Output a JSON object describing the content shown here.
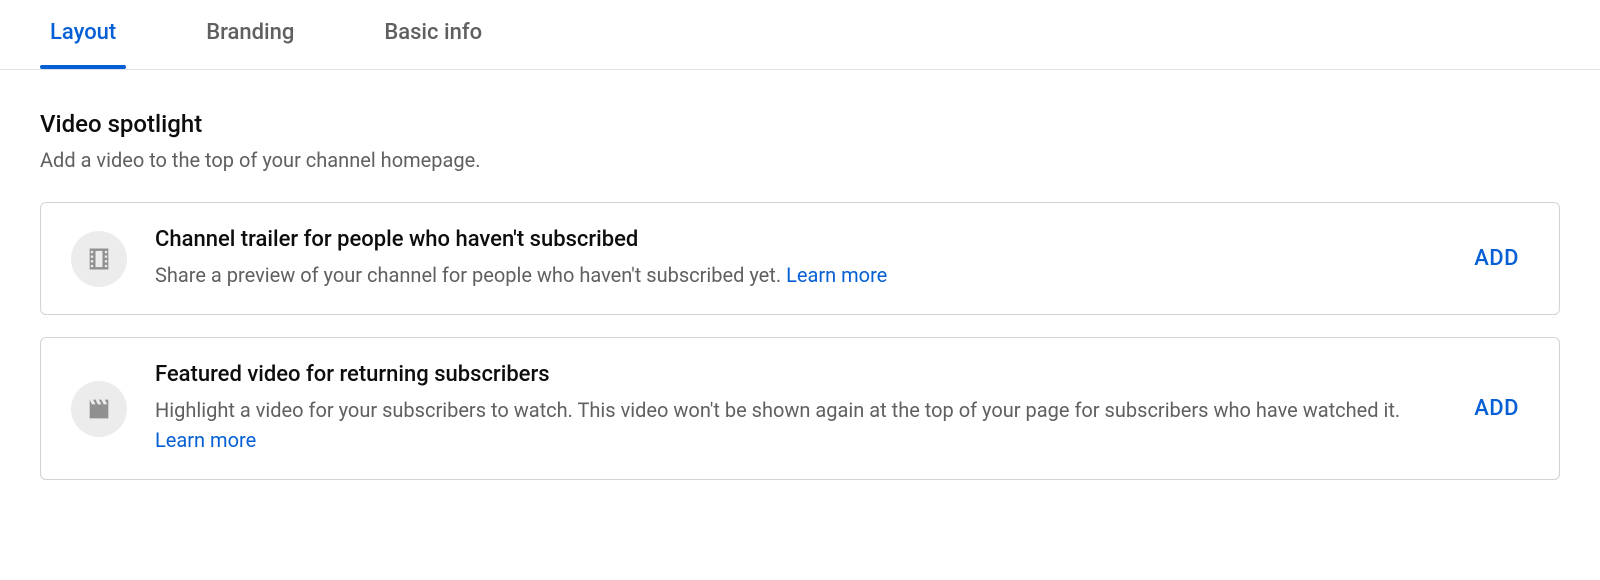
{
  "tabs": {
    "layout": "Layout",
    "branding": "Branding",
    "basic_info": "Basic info"
  },
  "section": {
    "title": "Video spotlight",
    "subtitle": "Add a video to the top of your channel homepage."
  },
  "cards": {
    "trailer": {
      "title": "Channel trailer for people who haven't subscribed",
      "desc": "Share a preview of your channel for people who haven't subscribed yet.  ",
      "learn_more": "Learn more",
      "action": "ADD"
    },
    "featured": {
      "title": "Featured video for returning subscribers",
      "desc": "Highlight a video for your subscribers to watch. This video won't be shown again at the top of your page for subscribers who have watched it.  ",
      "learn_more": "Learn more",
      "action": "ADD"
    }
  }
}
